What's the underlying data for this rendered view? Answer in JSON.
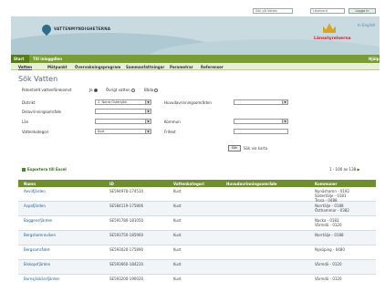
{
  "top": {
    "search_value": "Sök på Vatten",
    "password_value": "Lösenord",
    "login_label": "Logga in"
  },
  "brand": {
    "vat_name": "VATTENMYNDIGHETERNA",
    "lst_name": "Länsstyrelserna",
    "english_link": "In English",
    "accent": "#7a9c36"
  },
  "nav": {
    "items": [
      {
        "label": "Start"
      },
      {
        "label": "Till inloggdlen"
      }
    ],
    "help_label": "Hjälp",
    "sub_items": [
      {
        "label": "Vatten"
      },
      {
        "label": "Mätpunkt"
      },
      {
        "label": "Övervakningsprogram"
      },
      {
        "label": "Sammanfattningar"
      },
      {
        "label": "Parametrar"
      },
      {
        "label": "Referenser"
      }
    ]
  },
  "search": {
    "title": "Sök Vatten",
    "potential_label": "Potentiellt vattenförekomst",
    "radio_options": [
      {
        "label": "Ja"
      },
      {
        "label": "Övrigt vatten"
      },
      {
        "label": "Båda"
      }
    ],
    "fields": {
      "distrikt_label": "Distrikt",
      "distrikt_value": "2. Norra Östersjön",
      "delavrinning_label": "Delavrinningsområde",
      "lan_label": "Län",
      "vattenkategori_label": "Vattenkategori",
      "vattenkategori_value": "Kust",
      "huvudavrinning_label": "Huvudavrinningsområden",
      "kommun_label": "Kommun",
      "fritext_label": "Fritext"
    },
    "search_button": "Sök",
    "map_link": "Sök via karta"
  },
  "results": {
    "export_label": "Exportera till Excel",
    "count_label": "1 - 100 av 138",
    "columns": [
      "Namn",
      "ID",
      "Vattenkategori",
      "Huvudavrinningsområde",
      "Kommuner"
    ],
    "rows": [
      {
        "name": "Aeviifjärden",
        "id": "SE594970-174510",
        "category": "Kust",
        "area": "",
        "municipality": "Nynäshamn - 0192\nSödertälje - 0181\nTrosa - 0488"
      },
      {
        "name": "Aspafjärden",
        "id": "SE584119-175806",
        "category": "Kust",
        "area": "",
        "municipality": "Norrtälje - 0188\nÖsthammar - 0382"
      },
      {
        "name": "Baggensfjärden",
        "id": "SE591780-181050",
        "category": "Kust",
        "area": "",
        "municipality": "Nacka - 0182\nVärmdö - 0120"
      },
      {
        "name": "Bergshamraviken",
        "id": "SE593750-185960",
        "category": "Kust",
        "area": "",
        "municipality": "Norrtälje - 0188"
      },
      {
        "name": "Bergsområdet",
        "id": "SE593020-175890",
        "category": "Kust",
        "area": "",
        "municipality": "Nyköping - 0480"
      },
      {
        "name": "Biskopsfjärden",
        "id": "SE593660-184220",
        "category": "Kust",
        "area": "",
        "municipality": "Värmdö - 0120"
      },
      {
        "name": "Bornsjöskärsfjärden",
        "id": "SE593200-190020",
        "category": "Kust",
        "area": "",
        "municipality": "Värmdö - 0120"
      }
    ]
  }
}
